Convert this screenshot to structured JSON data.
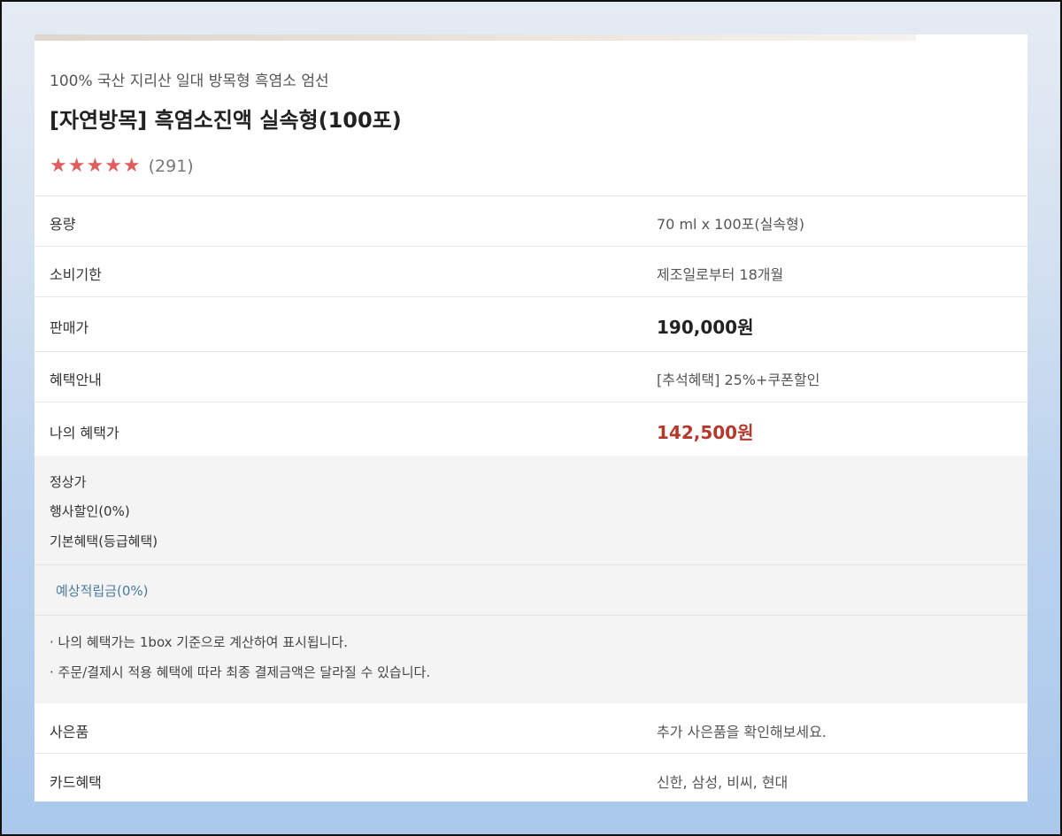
{
  "product": {
    "subtitle": "100% 국산 지리산 일대 방목형 흑염소 엄선",
    "title": "[자연방목] 흑염소진액 실속형(100포)",
    "stars": "★★★★★",
    "review_count": "(291)"
  },
  "rows": [
    {
      "label": "용량",
      "value": "70 ml x 100포(실속형)"
    },
    {
      "label": "소비기한",
      "value": "제조일로부터 18개월"
    },
    {
      "label": "판매가",
      "value": "190,000원"
    },
    {
      "label": "혜택안내",
      "value": "[추석혜택] 25%+쿠폰할인"
    },
    {
      "label": "나의 혜택가",
      "value": "142,500원"
    }
  ],
  "detail": {
    "regular_price_label": "정상가",
    "event_discount_label": "행사할인(0%)",
    "basic_benefit_label": "기본혜택(등급혜택)",
    "expected_points_label": "예상적립금(0%)",
    "notes": [
      "· 나의 혜택가는 1box 기준으로 계산하여 표시됩니다.",
      "· 주문/결제시 적용 혜택에 따라 최종 결제금액은 달라질 수 있습니다."
    ]
  },
  "extra_rows": [
    {
      "label": "사은품",
      "value": "추가 사은품을 확인해보세요."
    },
    {
      "label": "카드혜택",
      "value": "신한, 삼성, 비씨, 현대"
    }
  ],
  "colors": {
    "star": "#dd5f5f",
    "benefit_price": "#b43a2e",
    "points_link": "#4a7a9c"
  }
}
